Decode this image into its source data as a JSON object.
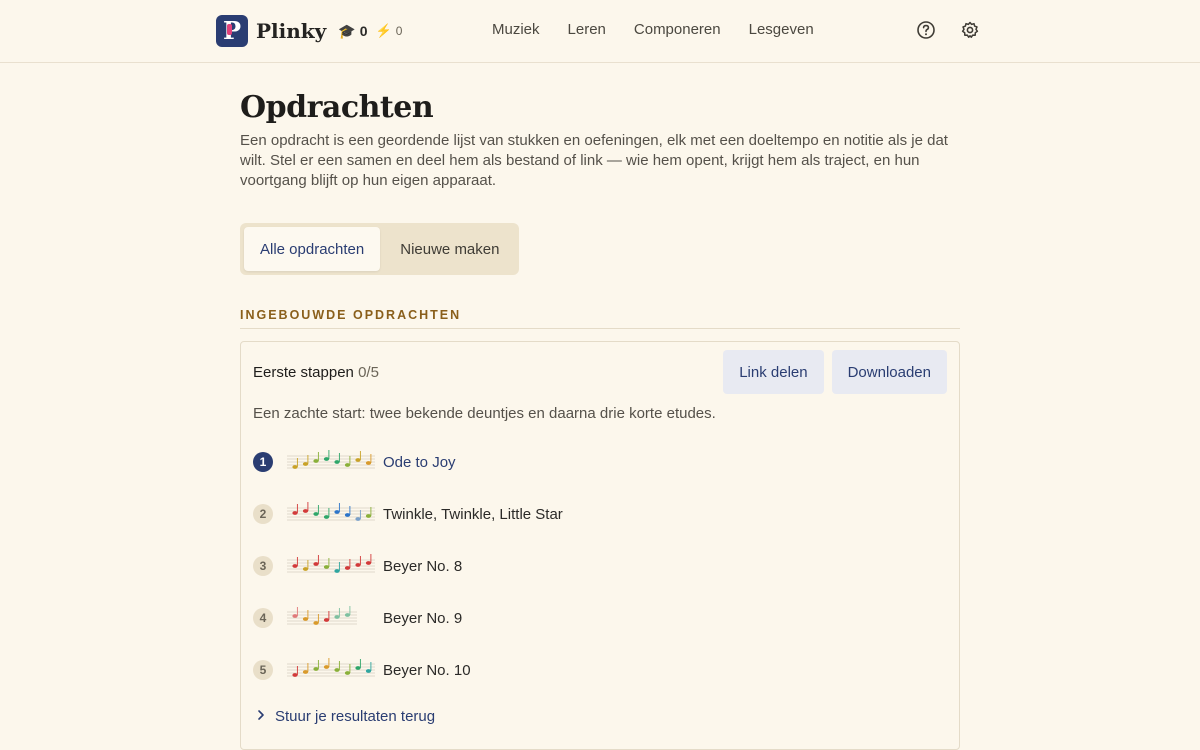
{
  "header": {
    "brand": "Plinky",
    "logo_letter": "P",
    "streak_count": "0",
    "energy_count": "0",
    "nav": [
      "Muziek",
      "Leren",
      "Componeren",
      "Lesgeven"
    ]
  },
  "page": {
    "title": "Opdrachten",
    "intro": "Een opdracht is een geordende lijst van stukken en oefeningen, elk met een doeltempo en notitie als je dat wilt. Stel er een samen en deel hem als bestand of link — wie hem opent, krijgt hem als traject, en hun voortgang blijft op hun eigen apparaat.",
    "tabs": [
      "Alle opdrachten",
      "Nieuwe maken"
    ],
    "active_tab": "Alle opdrachten",
    "section_label": "INGEBOUWDE OPDRACHTEN"
  },
  "assignment": {
    "title": "Eerste stappen",
    "progress": "0/5",
    "share_label": "Link delen",
    "download_label": "Downloaden",
    "description": "Een zachte start: twee bekende deuntjes en daarna drie korte etudes.",
    "items": [
      {
        "number": "1",
        "title": "Ode to Joy",
        "active": true,
        "note_colors": [
          "#c9a227",
          "#c9a227",
          "#8ab03a",
          "#2fa66a",
          "#2fa66a",
          "#8ab03a",
          "#c9a227",
          "#d99a2b"
        ]
      },
      {
        "number": "2",
        "title": "Twinkle, Twinkle, Little Star",
        "active": false,
        "note_colors": [
          "#d23a3a",
          "#d23a3a",
          "#2fa66a",
          "#2fa66a",
          "#2c74c9",
          "#2c74c9",
          "#7aa0c9",
          "#8ab03a"
        ]
      },
      {
        "number": "3",
        "title": "Beyer No. 8",
        "active": false,
        "note_colors": [
          "#d23a3a",
          "#c9a227",
          "#d23a3a",
          "#8ab03a",
          "#2fa6a0",
          "#d23a3a",
          "#d23a3a",
          "#d23a3a"
        ]
      },
      {
        "number": "4",
        "title": "Beyer No. 9",
        "active": false,
        "note_colors": [
          "#e07a7a",
          "#d99a2b",
          "#d99a2b",
          "#d23a3a",
          "#7ec0a0",
          "#7ec0a0"
        ]
      },
      {
        "number": "5",
        "title": "Beyer No. 10",
        "active": false,
        "note_colors": [
          "#d23a3a",
          "#d99a2b",
          "#8ab03a",
          "#d99a2b",
          "#8ab03a",
          "#8ab03a",
          "#2fa66a",
          "#2fa6a0"
        ]
      }
    ],
    "send_back_label": "Stuur je resultaten terug"
  },
  "colors": {
    "background": "#fcf7ec",
    "accent": "#2a3d72",
    "section_label": "#8a5f1b"
  },
  "icons": [
    "graduation-cap-icon",
    "bolt-icon",
    "help-icon",
    "settings-icon",
    "chevron-right-icon"
  ]
}
